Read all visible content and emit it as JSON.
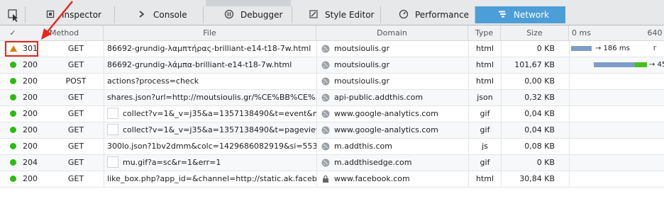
{
  "toolbar": {
    "tabs": [
      {
        "label": "Inspector",
        "icon": "inspector-icon"
      },
      {
        "label": "Console",
        "icon": "console-icon"
      },
      {
        "label": "Debugger",
        "icon": "debugger-icon"
      },
      {
        "label": "Style Editor",
        "icon": "style-editor-icon"
      },
      {
        "label": "Performance",
        "icon": "performance-icon"
      },
      {
        "label": "Network",
        "icon": "network-icon"
      }
    ],
    "selected": "Network"
  },
  "header": {
    "check": "✓",
    "method": "Method",
    "file": "File",
    "domain": "Domain",
    "type": "Type",
    "size": "Size",
    "wf_tick0": "0 ms",
    "wf_tick1": "640 r"
  },
  "rows": [
    {
      "status": "301",
      "status_kind": "redirect",
      "method": "GET",
      "file": "86692-grundig-λαμπτήρας-brilliant-e14-t18-7w.html",
      "thumb": false,
      "domain": "moutsioulis.gr",
      "domain_icon": "globe-icon",
      "type": "html",
      "size": "0 KB",
      "timing": "→ 186 ms"
    },
    {
      "status": "200",
      "status_kind": "ok",
      "method": "GET",
      "file": "86692-grundig-λάμπα-brilliant-e14-t18-7w.html",
      "thumb": false,
      "domain": "moutsioulis.gr",
      "domain_icon": "globe-icon",
      "type": "html",
      "size": "101,67 KB",
      "timing": "→ 45"
    },
    {
      "status": "200",
      "status_kind": "ok",
      "method": "POST",
      "file": "actions?process=check",
      "thumb": false,
      "domain": "moutsioulis.gr",
      "domain_icon": "globe-icon",
      "type": "html",
      "size": "0,00 KB",
      "timing": ""
    },
    {
      "status": "200",
      "status_kind": "ok",
      "method": "GET",
      "file": "shares.json?url=http://moutsioulis.gr/%CE%BB%CE%...",
      "thumb": false,
      "domain": "api-public.addthis.com",
      "domain_icon": "globe-icon",
      "type": "json",
      "size": "0,32 KB",
      "timing": ""
    },
    {
      "status": "200",
      "status_kind": "ok",
      "method": "GET",
      "file": "collect?v=1&_v=j35&a=1357138490&t=event&ni...",
      "thumb": true,
      "domain": "www.google-analytics.com",
      "domain_icon": "globe-icon",
      "type": "gif",
      "size": "0,04 KB",
      "timing": ""
    },
    {
      "status": "200",
      "status_kind": "ok",
      "method": "GET",
      "file": "collect?v=1&_v=j35&a=1357138490&t=pageview...",
      "thumb": true,
      "domain": "www.google-analytics.com",
      "domain_icon": "globe-icon",
      "type": "gif",
      "size": "0,04 KB",
      "timing": ""
    },
    {
      "status": "200",
      "status_kind": "ok",
      "method": "GET",
      "file": "300lo.json?1bv2dmm&colc=1429686082919&si=5537...",
      "thumb": false,
      "domain": "m.addthis.com",
      "domain_icon": "globe-icon",
      "type": "js",
      "size": "0,08 KB",
      "timing": ""
    },
    {
      "status": "204",
      "status_kind": "ok",
      "method": "GET",
      "file": "mu.gif?a=sc&r=1&err=1",
      "thumb": true,
      "domain": "m.addthisedge.com",
      "domain_icon": "globe-icon",
      "type": "gif",
      "size": "0 KB",
      "timing": ""
    },
    {
      "status": "200",
      "status_kind": "ok",
      "method": "GET",
      "file": "like_box.php?app_id=&channel=http://static.ak.faceb...",
      "thumb": false,
      "domain": "www.facebook.com",
      "domain_icon": "lock-icon",
      "type": "html",
      "size": "30,84 KB",
      "timing": ""
    }
  ],
  "colors": {
    "accent": "#4c9ed9",
    "ok": "#2cbb0f",
    "redirect": "#d97e00",
    "annotation": "#e8261c",
    "wf_wait": "#7b9dc7",
    "wf_receive": "#44c21b"
  }
}
